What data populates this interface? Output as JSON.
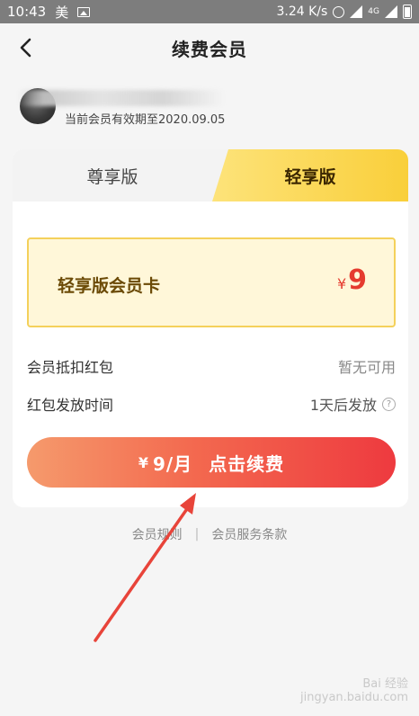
{
  "status_bar": {
    "time": "10:43",
    "carrier": "美",
    "speed": "3.24 K/s",
    "net_label": "4G"
  },
  "header": {
    "title": "续费会员"
  },
  "user": {
    "expiry_text": "当前会员有效期至2020.09.05"
  },
  "tabs": [
    {
      "label": "尊享版",
      "active": false
    },
    {
      "label": "轻享版",
      "active": true
    }
  ],
  "plan": {
    "name": "轻享版会员卡",
    "currency": "¥",
    "price": "9"
  },
  "rows": [
    {
      "label": "会员抵扣红包",
      "value": "暂无可用"
    },
    {
      "label": "红包发放时间",
      "value": "1天后发放"
    }
  ],
  "renew_button": {
    "currency": "¥",
    "price_text": "9/月",
    "action": "点击续费"
  },
  "footer": {
    "rules": "会员规则",
    "separator": "|",
    "terms": "会员服务条款"
  },
  "watermark": {
    "line1": "Bai 经验",
    "line2": "jingyan.baidu.com"
  },
  "colors": {
    "accent_gold": "#f9cf3a",
    "price_red": "#e53b2f",
    "button_gradient_start": "#f59a6c",
    "button_gradient_end": "#ee3a3f",
    "annotation_arrow": "#e8443a"
  }
}
